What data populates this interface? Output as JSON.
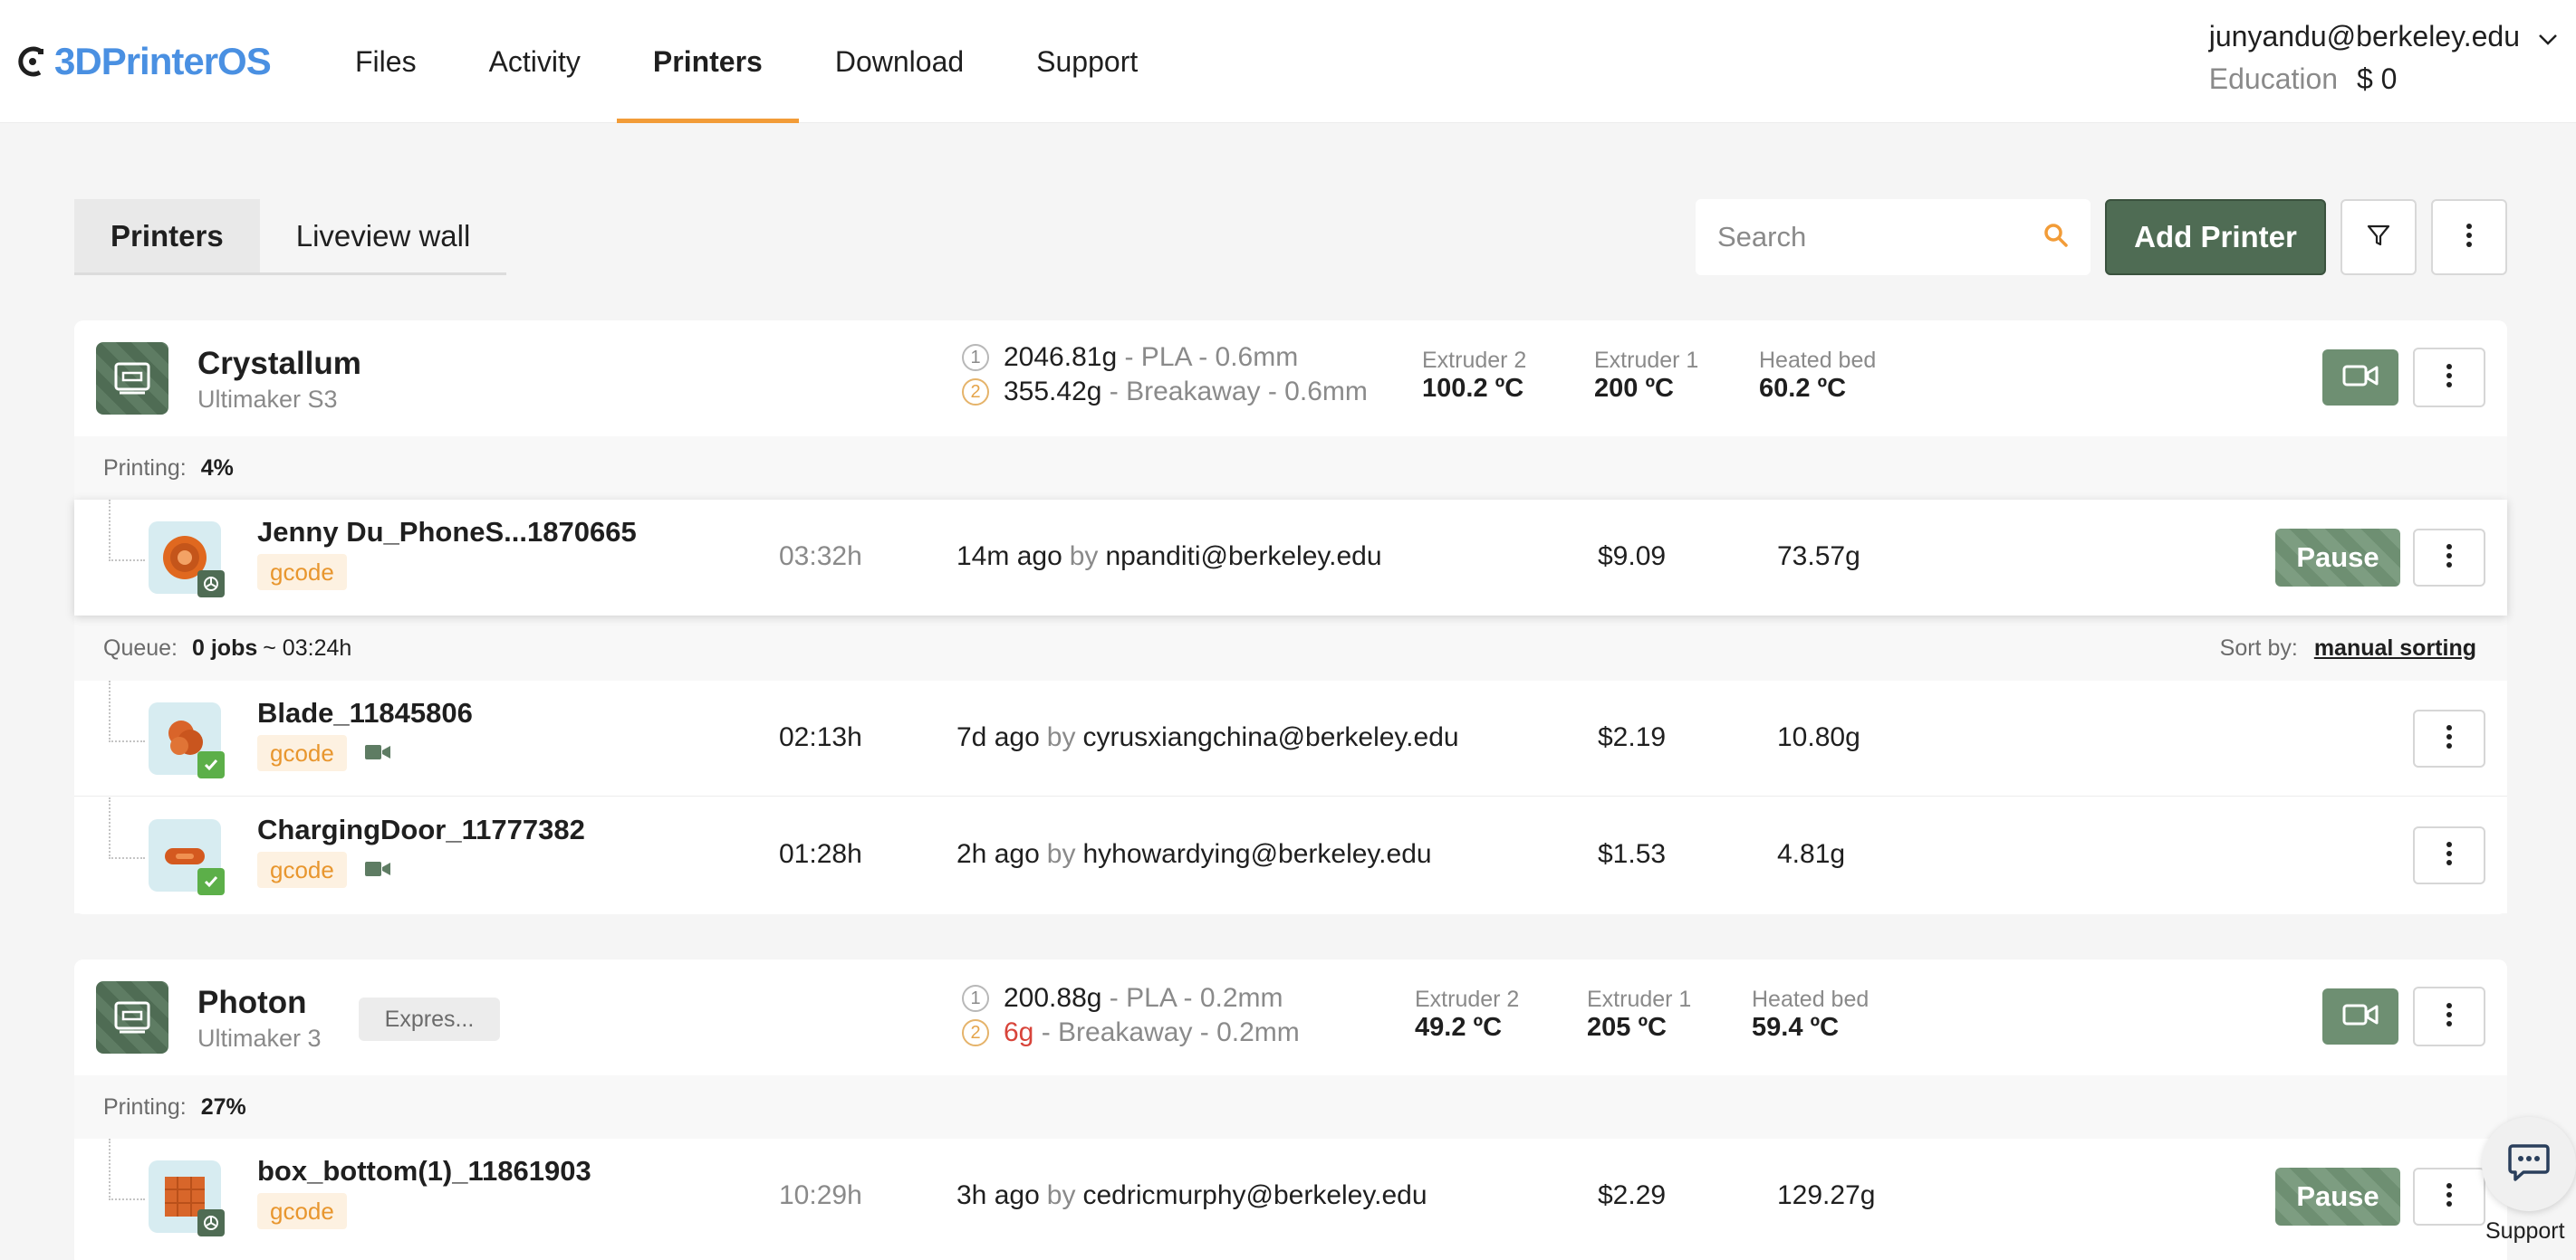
{
  "brand": {
    "name": "3DPrinterOS",
    "accent": "#4a90e2",
    "highlight": "#f29c38",
    "primary_green": "#4f6c54"
  },
  "nav": {
    "items": [
      {
        "label": "Files"
      },
      {
        "label": "Activity"
      },
      {
        "label": "Printers",
        "active": true
      },
      {
        "label": "Download"
      },
      {
        "label": "Support"
      }
    ]
  },
  "account": {
    "email": "junyandu@berkeley.edu",
    "plan": "Education",
    "balance": "$ 0"
  },
  "toolbar": {
    "tabs": [
      {
        "label": "Printers",
        "active": true
      },
      {
        "label": "Liveview wall"
      }
    ],
    "search_placeholder": "Search",
    "add_label": "Add Printer"
  },
  "printers": [
    {
      "name": "Crystallum",
      "model": "Ultimaker S3",
      "materials": [
        {
          "num": "1",
          "weight": "2046.81g",
          "rest": "- PLA - 0.6mm"
        },
        {
          "num": "2",
          "weight": "355.42g",
          "rest": "- Breakaway - 0.6mm"
        }
      ],
      "temps": [
        {
          "label": "Extruder 2",
          "value": "100.2 ºC"
        },
        {
          "label": "Extruder 1",
          "value": "200 ºC"
        },
        {
          "label": "Heated bed",
          "value": "60.2 ºC"
        }
      ],
      "status_label": "Printing:",
      "status_value": "4%",
      "current_job": {
        "name": "Jenny Du_PhoneS...1870665",
        "tag": "gcode",
        "time": "03:32h",
        "ago": "14m ago",
        "by": "by",
        "user": "npanditi@berkeley.edu",
        "cost": "$9.09",
        "weight": "73.57g",
        "action": "Pause"
      },
      "queue": {
        "label": "Queue:",
        "count": "0 jobs",
        "estimate": "~ 03:24h",
        "sort_label": "Sort by:",
        "sort_value": "manual sorting"
      },
      "queued_jobs": [
        {
          "name": "Blade_11845806",
          "tag": "gcode",
          "time": "02:13h",
          "ago": "7d ago",
          "by": "by",
          "user": "cyrusxiangchina@berkeley.edu",
          "cost": "$2.19",
          "weight": "10.80g"
        },
        {
          "name": "ChargingDoor_11777382",
          "tag": "gcode",
          "time": "01:28h",
          "ago": "2h ago",
          "by": "by",
          "user": "hyhowardying@berkeley.edu",
          "cost": "$1.53",
          "weight": "4.81g"
        }
      ]
    },
    {
      "name": "Photon",
      "model": "Ultimaker 3",
      "badge": "Expres...",
      "materials": [
        {
          "num": "1",
          "weight": "200.88g",
          "rest": "- PLA - 0.2mm"
        },
        {
          "num": "2",
          "weight": "6g",
          "rest": "- Breakaway - 0.2mm",
          "low": true
        }
      ],
      "temps": [
        {
          "label": "Extruder 2",
          "value": "49.2 ºC"
        },
        {
          "label": "Extruder 1",
          "value": "205 ºC"
        },
        {
          "label": "Heated bed",
          "value": "59.4 ºC"
        }
      ],
      "status_label": "Printing:",
      "status_value": "27%",
      "current_job": {
        "name": "box_bottom(1)_11861903",
        "tag": "gcode",
        "time": "10:29h",
        "ago": "3h ago",
        "by": "by",
        "user": "cedricmurphy@berkeley.edu",
        "cost": "$2.29",
        "weight": "129.27g",
        "action": "Pause"
      }
    }
  ],
  "support_widget": {
    "label": "Support"
  }
}
